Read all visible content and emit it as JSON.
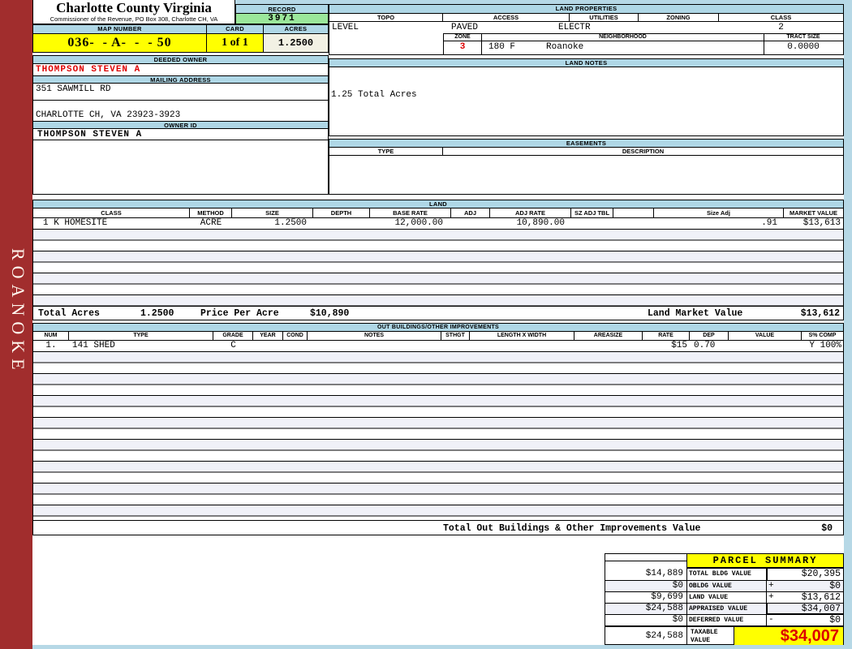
{
  "sidebar": {
    "region_label": "ROANOKE"
  },
  "header": {
    "county_title": "Charlotte County Virginia",
    "county_subtitle": "Commissioner of the Revenue, PO Box 308, Charlotte CH, VA",
    "record_label": "RECORD",
    "record_value": "3971",
    "map_label": "MAP NUMBER",
    "map_value": "036-  - A-  -  - 50",
    "card_label": "CARD",
    "card_value": "1 of 1",
    "acres_label": "ACRES",
    "acres_value": "1.2500"
  },
  "owner": {
    "deeded_owner_label": "DEEDED OWNER",
    "deeded_owner": "THOMPSON STEVEN A",
    "mailing_address_label": "MAILING ADDRESS",
    "address_line1": "351 SAWMILL RD",
    "address_line2": "CHARLOTTE CH, VA 23923-3923",
    "owner_id_label": "OWNER ID",
    "owner_id": "THOMPSON STEVEN A"
  },
  "land_properties": {
    "title": "LAND PROPERTIES",
    "topo_label": "TOPO",
    "topo": "LEVEL",
    "access_label": "ACCESS",
    "access": "PAVED",
    "utilities_label": "UTILITIES",
    "utilities": "ELECTR",
    "zoning_label": "ZONING",
    "zoning": "",
    "class_label": "CLASS",
    "class": "2",
    "zone_label": "ZONE",
    "zone": "3",
    "neighborhood_label": "NEIGHBORHOOD",
    "neighborhood_code": "180 F",
    "neighborhood": "Roanoke",
    "tract_size_label": "TRACT SIZE",
    "tract_size": "0.0000"
  },
  "land_notes": {
    "title": "LAND NOTES",
    "note": "1.25 Total Acres"
  },
  "easements": {
    "title": "EASEMENTS",
    "type_label": "TYPE",
    "description_label": "DESCRIPTION"
  },
  "land": {
    "title": "LAND",
    "columns": [
      "CLASS",
      "METHOD",
      "SIZE",
      "DEPTH",
      "BASE RATE",
      "ADJ",
      "ADJ RATE",
      "SZ ADJ TBL",
      "",
      "Size Adj",
      "MARKET VALUE"
    ],
    "rows": [
      {
        "class": "1 K HOMESITE",
        "method": "ACRE",
        "size": "1.2500",
        "depth": "",
        "base_rate": "12,000.00",
        "adj": "",
        "adj_rate": "10,890.00",
        "sz_adj_tbl": "",
        "size_adj": ".91",
        "market_value": "$13,613"
      }
    ],
    "total_acres_label": "Total Acres",
    "total_acres": "1.2500",
    "price_per_acre_label": "Price Per Acre",
    "price_per_acre": "$10,890",
    "market_value_label": "Land Market Value",
    "market_value": "$13,612"
  },
  "out_buildings": {
    "title": "OUT BUILDINGS/OTHER IMPROVEMENTS",
    "columns": [
      "NUM",
      "TYPE",
      "GRADE",
      "YEAR",
      "COND",
      "NOTES",
      "STHGT",
      "LENGTH X WIDTH",
      "AREASIZE",
      "RATE",
      "DEP",
      "VALUE",
      "S% COMP"
    ],
    "rows": [
      {
        "num": "1.",
        "type": "141 SHED",
        "grade": "C",
        "year": "",
        "cond": "",
        "notes": "",
        "sthgt": "",
        "length_width": "",
        "areasize": "",
        "rate": "$15",
        "dep": "0.70",
        "value": "",
        "s_comp": "Y 100%"
      }
    ],
    "total_label": "Total Out Buildings & Other Improvements Value",
    "total_value": "$0"
  },
  "parcel_summary": {
    "title": "PARCEL SUMMARY",
    "rows": [
      {
        "prior": "$14,889",
        "label": "TOTAL BLDG VALUE",
        "op": "",
        "value": "$20,395"
      },
      {
        "prior": "$0",
        "label": "OBLDG VALUE",
        "op": "+",
        "value": "$0"
      },
      {
        "prior": "$9,699",
        "label": "LAND VALUE",
        "op": "+",
        "value": "$13,612"
      },
      {
        "prior": "$24,588",
        "label": "APPRAISED VALUE",
        "op": "",
        "value": "$34,007"
      },
      {
        "prior": "$0",
        "label": "DEFERRED VALUE",
        "op": "-",
        "value": "$0"
      }
    ],
    "taxable_prior": "$24,588",
    "taxable_label": "TAXABLE VALUE",
    "taxable_value": "$34,007"
  },
  "colors": {
    "header_bar_blue": "#AFD7E6",
    "record_green": "#9BE79B",
    "highlight_yellow": "#FFFF00",
    "sidebar_red": "#A12D2D",
    "alert_red": "#DD0000",
    "acres_beige": "#F2F1E4",
    "stripe_lavender": "#F0F1F8"
  }
}
